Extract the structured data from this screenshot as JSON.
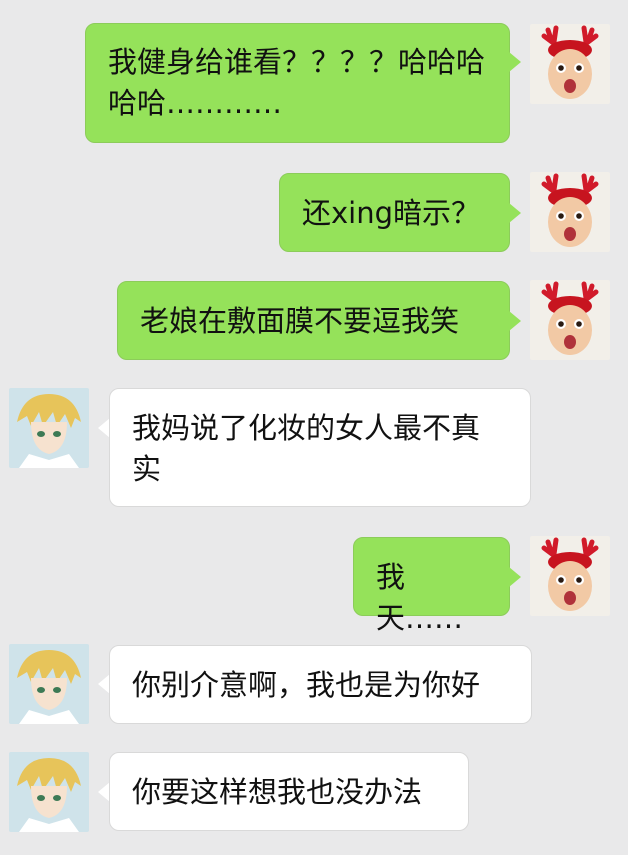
{
  "messages": [
    {
      "side": "me",
      "text": "我健身给谁看？？？？哈哈哈哈哈…………"
    },
    {
      "side": "me",
      "text": "还xing暗示？"
    },
    {
      "side": "me",
      "text": "老娘在敷面膜不要逗我笑"
    },
    {
      "side": "them",
      "text": "我妈说了化妆的女人最不真实"
    },
    {
      "side": "me",
      "text": "我天……"
    },
    {
      "side": "them",
      "text": "你别介意啊，我也是为你好"
    },
    {
      "side": "them",
      "text": "你要这样想我也没办法"
    }
  ],
  "avatars": {
    "me": "baby-reindeer-avatar",
    "them": "anime-blonde-boy-avatar"
  },
  "colors": {
    "background": "#e9e9ea",
    "my_bubble": "#95e25a",
    "their_bubble": "#ffffff"
  }
}
